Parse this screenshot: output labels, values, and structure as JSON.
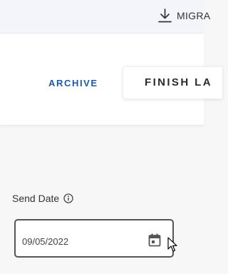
{
  "header": {
    "migrate_label": "MIGRA",
    "migrate_icon": "download-icon"
  },
  "actions": {
    "archive_label": "ARCHIVE",
    "finish_label": "FINISH LA"
  },
  "send_date": {
    "label": "Send Date",
    "info_icon": "info-icon",
    "value": "09/05/2022",
    "calendar_icon": "calendar-icon"
  },
  "colors": {
    "accent": "#1d5aa6",
    "topbar_bg": "#f4f5fb",
    "page_bg": "#f7f7f7"
  }
}
